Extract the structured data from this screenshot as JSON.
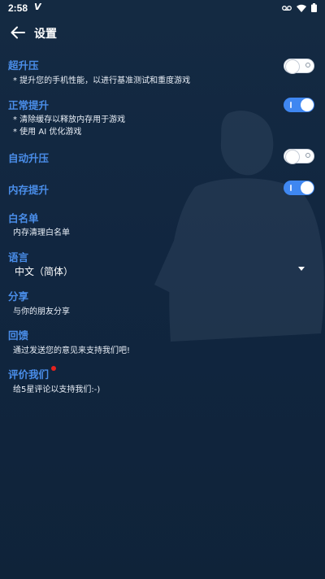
{
  "status_bar": {
    "time": "2:58",
    "carrier_glyph": "V",
    "icons": [
      "voicemail-icon",
      "wifi-icon",
      "battery-icon"
    ]
  },
  "app_bar": {
    "title": "设置",
    "back_icon": "arrow-left-icon"
  },
  "settings": {
    "super_boost": {
      "title": "超升压",
      "desc": "* 提升您的手机性能，以进行基准测试和重度游戏",
      "enabled": false
    },
    "normal_boost": {
      "title": "正常提升",
      "desc_lines": [
        "* 清除缓存以释放内存用于游戏",
        "* 使用 AI 优化游戏"
      ],
      "enabled": true
    },
    "auto_boost": {
      "title": "自动升压",
      "enabled": false
    },
    "memory_boost": {
      "title": "内存提升",
      "enabled": true
    },
    "whitelist": {
      "title": "白名单",
      "desc": "内存清理白名单"
    },
    "language": {
      "title": "语言",
      "selected": "中文（简体）"
    },
    "share": {
      "title": "分享",
      "desc": "与你的朋友分享"
    },
    "feedback": {
      "title": "回馈",
      "desc": "通过发送您的意见来支持我们吧!"
    },
    "rate_us": {
      "title": "评价我们",
      "desc": "给5星评论以支持我们:-)",
      "has_badge": true
    }
  },
  "colors": {
    "accent": "#4a8eea",
    "toggle_on": "#3f87f1",
    "badge": "#e5221e",
    "background": "#132a42"
  }
}
